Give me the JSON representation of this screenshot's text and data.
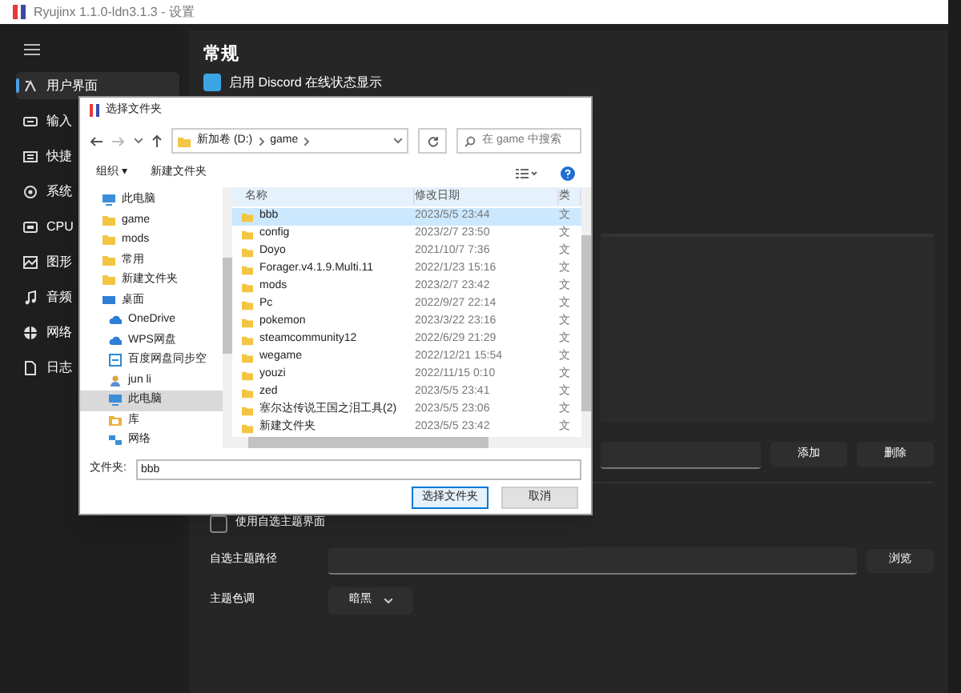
{
  "window": {
    "title": "Ryujinx 1.1.0-ldn3.1.3 - 设置"
  },
  "sidebar": {
    "items": [
      {
        "label": "用户界面",
        "selected": true
      },
      {
        "label": "输入",
        "selected": false
      },
      {
        "label": "快捷",
        "selected": false
      },
      {
        "label": "系统",
        "selected": false
      },
      {
        "label": "CPU",
        "selected": false
      },
      {
        "label": "图形",
        "selected": false
      },
      {
        "label": "音频",
        "selected": false
      },
      {
        "label": "网络",
        "selected": false
      },
      {
        "label": "日志",
        "selected": false
      }
    ]
  },
  "content": {
    "heading": "常规",
    "discord_checkbox": {
      "label": "启用 Discord 在线状态显示",
      "checked": true
    },
    "game_dirs": {
      "add_button": "添加",
      "remove_button": "删除"
    },
    "custom_theme_checkbox": {
      "label": "使用自选主题界面",
      "checked": false
    },
    "theme_path": {
      "label": "自选主题路径",
      "browse_button": "浏览"
    },
    "theme_tone": {
      "label": "主题色调",
      "value": "暗黑"
    }
  },
  "dialog": {
    "title": "选择文件夹",
    "breadcrumb": [
      "新加卷 (D:)",
      "game"
    ],
    "search_placeholder": "在 game 中搜索",
    "toolbar": [
      "组织 ▾",
      "新建文件夹"
    ],
    "nav": [
      {
        "label": "此电脑",
        "kind": "pc",
        "selected": false
      },
      {
        "label": "game",
        "kind": "folder",
        "selected": false
      },
      {
        "label": "mods",
        "kind": "folder",
        "selected": false
      },
      {
        "label": "常用",
        "kind": "folder",
        "selected": false
      },
      {
        "label": "新建文件夹",
        "kind": "folder",
        "selected": false
      },
      {
        "label": "桌面",
        "kind": "desktop",
        "selected": false,
        "children": [
          {
            "label": "OneDrive",
            "kind": "cloud",
            "selected": false
          },
          {
            "label": "WPS网盘",
            "kind": "cloud",
            "selected": false
          },
          {
            "label": "百度网盘同步空",
            "kind": "sync",
            "selected": false
          },
          {
            "label": "jun li",
            "kind": "user",
            "selected": false
          },
          {
            "label": "此电脑",
            "kind": "pc",
            "selected": true
          },
          {
            "label": "库",
            "kind": "library",
            "selected": false
          },
          {
            "label": "网络",
            "kind": "network",
            "selected": false
          }
        ]
      }
    ],
    "columns": [
      "名称",
      "修改日期",
      "类"
    ],
    "rows": [
      {
        "name": "bbb",
        "date": "2023/5/5 23:44",
        "type": "文",
        "selected": true
      },
      {
        "name": "config",
        "date": "2023/2/7 23:50",
        "type": "文",
        "selected": false
      },
      {
        "name": "Doyo",
        "date": "2021/10/7 7:36",
        "type": "文",
        "selected": false
      },
      {
        "name": "Forager.v4.1.9.Multi.11",
        "date": "2022/1/23 15:16",
        "type": "文",
        "selected": false
      },
      {
        "name": "mods",
        "date": "2023/2/7 23:42",
        "type": "文",
        "selected": false
      },
      {
        "name": "Pc",
        "date": "2022/9/27 22:14",
        "type": "文",
        "selected": false
      },
      {
        "name": "pokemon",
        "date": "2023/3/22 23:16",
        "type": "文",
        "selected": false
      },
      {
        "name": "steamcommunity12",
        "date": "2022/6/29 21:29",
        "type": "文",
        "selected": false
      },
      {
        "name": "wegame",
        "date": "2022/12/21 15:54",
        "type": "文",
        "selected": false
      },
      {
        "name": "youzi",
        "date": "2022/11/15 0:10",
        "type": "文",
        "selected": false
      },
      {
        "name": "zed",
        "date": "2023/5/5 23:41",
        "type": "文",
        "selected": false
      },
      {
        "name": "塞尔达传说王国之泪工具(2)",
        "date": "2023/5/5 23:06",
        "type": "文",
        "selected": false
      },
      {
        "name": "新建文件夹",
        "date": "2023/5/5 23:42",
        "type": "文",
        "selected": false
      }
    ],
    "folder_label": "文件夹:",
    "folder_value": "bbb",
    "buttons": [
      {
        "label": "选择文件夹",
        "kind": "primary"
      },
      {
        "label": "取消",
        "kind": "secondary"
      }
    ]
  }
}
